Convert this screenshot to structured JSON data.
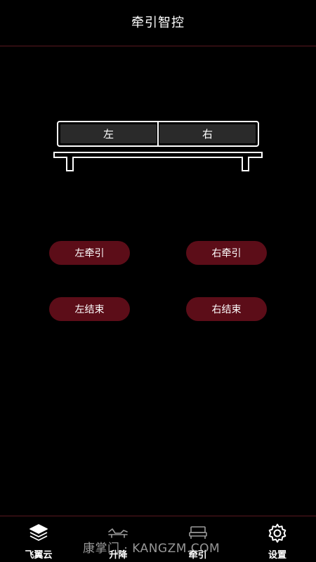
{
  "header": {
    "title": "牵引智控"
  },
  "bed": {
    "left_label": "左",
    "right_label": "右"
  },
  "actions": {
    "left_pull": "左牵引",
    "right_pull": "右牵引",
    "left_end": "左结束",
    "right_end": "右结束"
  },
  "nav": {
    "items": [
      {
        "label": "飞翼云",
        "icon": "layers-icon"
      },
      {
        "label": "升降",
        "icon": "adjustable-bed-icon"
      },
      {
        "label": "牵引",
        "icon": "bed-icon"
      },
      {
        "label": "设置",
        "icon": "gear-icon"
      }
    ]
  },
  "watermark": "康掌门 · KANGZM.COM",
  "colors": {
    "background": "#000000",
    "accent": "#5c0d18",
    "divider": "#5a1820",
    "mattress_fill": "#2a2a2a"
  }
}
